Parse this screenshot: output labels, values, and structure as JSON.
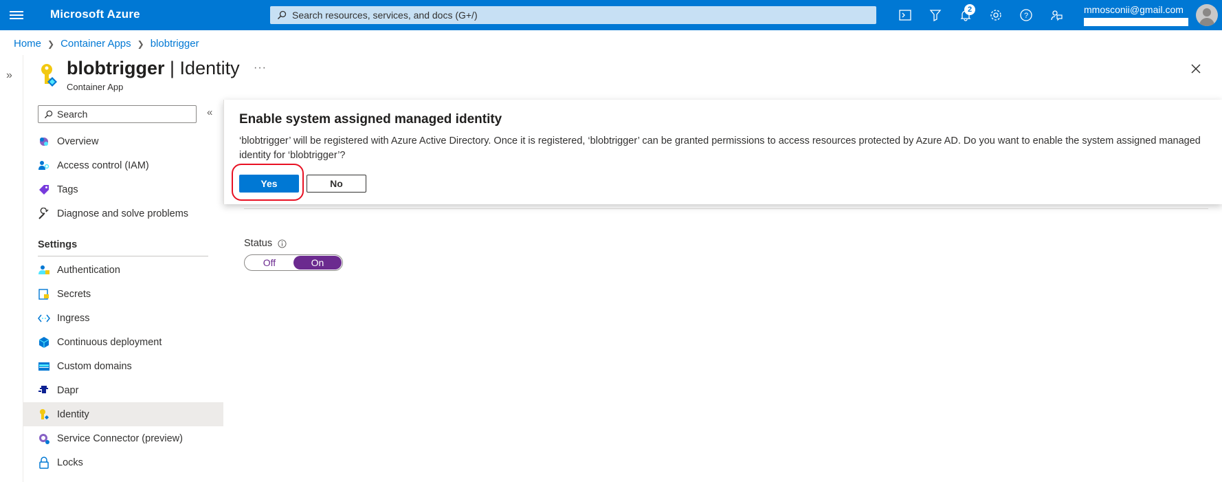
{
  "topbar": {
    "brand": "Microsoft Azure",
    "search_placeholder": "Search resources, services, and docs (G+/)",
    "notifications_count": "2",
    "account_email": "mmosconii@gmail.com",
    "icons": [
      "cloud-shell-icon",
      "directory-filter-icon",
      "notifications-icon",
      "settings-icon",
      "help-icon",
      "feedback-icon"
    ]
  },
  "breadcrumb": [
    "Home",
    "Container Apps",
    "blobtrigger"
  ],
  "header": {
    "resource_name": "blobtrigger",
    "separator": "|",
    "page": "Identity",
    "resource_type": "Container App",
    "more": "···"
  },
  "menu": {
    "search_placeholder": "Search",
    "top_items": [
      {
        "label": "Overview",
        "icon": "overview-icon"
      },
      {
        "label": "Access control (IAM)",
        "icon": "iam-icon"
      },
      {
        "label": "Tags",
        "icon": "tag-icon"
      },
      {
        "label": "Diagnose and solve problems",
        "icon": "wrench-icon"
      }
    ],
    "settings_heading": "Settings",
    "settings_items": [
      {
        "label": "Authentication",
        "icon": "authentication-icon"
      },
      {
        "label": "Secrets",
        "icon": "secrets-icon"
      },
      {
        "label": "Ingress",
        "icon": "ingress-icon"
      },
      {
        "label": "Continuous deployment",
        "icon": "deployment-icon"
      },
      {
        "label": "Custom domains",
        "icon": "domains-icon"
      },
      {
        "label": "Dapr",
        "icon": "dapr-icon"
      },
      {
        "label": "Identity",
        "icon": "identity-icon",
        "active": true
      },
      {
        "label": "Service Connector (preview)",
        "icon": "service-connector-icon"
      },
      {
        "label": "Locks",
        "icon": "lock-icon"
      }
    ]
  },
  "content": {
    "status_label": "Status",
    "toggle_off": "Off",
    "toggle_on": "On",
    "toggle_selected": "On"
  },
  "dialog": {
    "title": "Enable system assigned managed identity",
    "message": "‘blobtrigger’ will be registered with Azure Active Directory. Once it is registered, ‘blobtrigger’ can be granted permissions to access resources protected by Azure AD. Do you want to enable the system assigned managed identity for ‘blobtrigger’?",
    "yes_label": "Yes",
    "no_label": "No"
  },
  "colors": {
    "azure_blue": "#0078d4",
    "toggle_purple": "#6b2a8f",
    "highlight_red": "#e81123"
  }
}
